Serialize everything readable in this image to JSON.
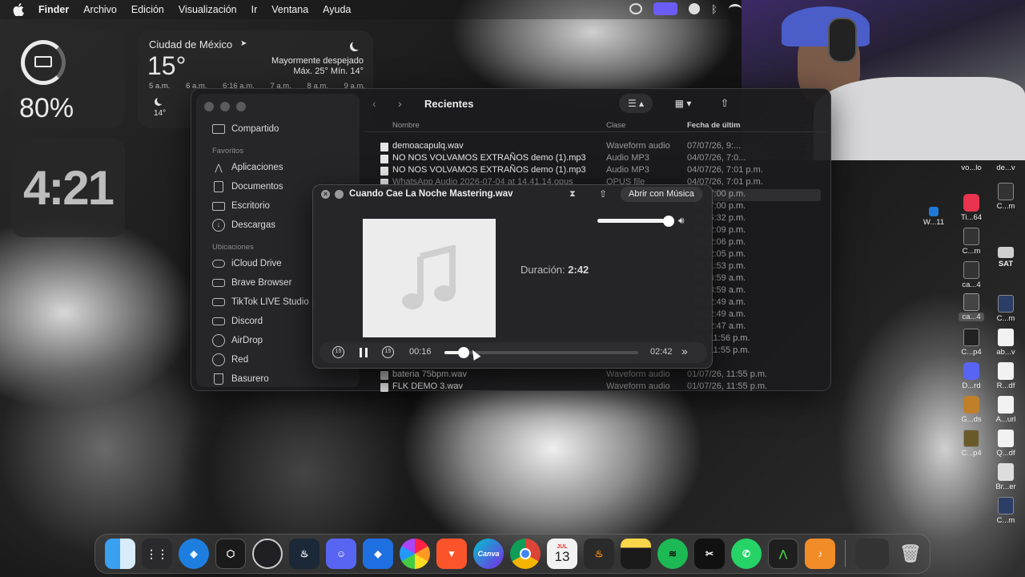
{
  "menubar": {
    "items": [
      "Finder",
      "Archivo",
      "Edición",
      "Visualización",
      "Ir",
      "Ventana",
      "Ayuda"
    ]
  },
  "battery_widget": {
    "percent": "80%"
  },
  "clock_widget": {
    "time": "4:21"
  },
  "weather_widget": {
    "city": "Ciudad de México",
    "temp": "15°",
    "condition": "Mayormente despejado",
    "range": "Máx. 25° Mín. 14°",
    "hours": [
      "5 a.m.",
      "6 a.m.",
      "6:16 a.m.",
      "7 a.m.",
      "8 a.m.",
      "9 a.m."
    ],
    "sub_temp": "14°"
  },
  "finder": {
    "title": "Recientes",
    "sidebar": {
      "top_item": "Compartido",
      "favorites_header": "Favoritos",
      "favorites": [
        "Aplicaciones",
        "Documentos",
        "Escritorio",
        "Descargas"
      ],
      "locations_header": "Ubicaciones",
      "locations": [
        "iCloud Drive",
        "Brave Browser",
        "TikTok LIVE Studio 1",
        "Discord",
        "AirDrop",
        "Red",
        "Basurero"
      ]
    },
    "columns": {
      "name": "Nombre",
      "kind": "Clase",
      "date": "Fecha de últim"
    },
    "files": [
      {
        "name": "demoacapulq.wav",
        "kind": "Waveform audio",
        "date": "07/07/26, 9:..."
      },
      {
        "name": "NO NOS VOLVAMOS EXTRAÑOS demo  (1).mp3",
        "kind": "Audio MP3",
        "date": "04/07/26, 7:0..."
      },
      {
        "name": "NO NOS VOLVAMOS EXTRAÑOS demo  (1).mp3",
        "kind": "Audio MP3",
        "date": "04/07/26, 7:01 p.m."
      },
      {
        "name": "WhatsApp Audio 2026-07-04 at 14.41.14.opus",
        "kind": "OPUS file",
        "date": "04/07/26, 7:01 p.m."
      }
    ],
    "partial_dates": [
      "26, 7:00 p.m.",
      "26, 7:00 p.m.",
      "26, 6:32 p.m.",
      "26, 2:09 p.m.",
      "26, 2:06 p.m.",
      "26, 2:05 p.m.",
      "26, 1:53 p.m.",
      "26, 3:59 a.m.",
      "26, 3:59 a.m.",
      "26, 2:49 a.m.",
      "26, 2:49 a.m.",
      "26, 2:47 a.m.",
      "26, 11:56 p.m.",
      "26, 11:55 p.m."
    ],
    "bottom_files": [
      {
        "name": "bateria 75bpm.wav",
        "kind": "Waveform audio",
        "date": "01/07/26, 11:55 p.m."
      },
      {
        "name": "FLK DEMO 3.wav",
        "kind": "Waveform audio",
        "date": "01/07/26, 11:55 p.m."
      }
    ]
  },
  "player": {
    "title": "Cuando Cae La Noche Mastering.wav",
    "open_with": "Abrir con Música",
    "duration_label": "Duración:",
    "duration_value": "2:42",
    "elapsed": "00:16",
    "total": "02:42",
    "progress": 0.1,
    "volume": 1.0
  },
  "desktop_icons": [
    "vo...lo",
    "de...v",
    "C...m",
    "Ti...64",
    "W...11",
    "C...m",
    "SAT",
    "ca...4",
    "C...m",
    "ca...4",
    "C...p4",
    "ab...v",
    "D...rd",
    "R...df",
    "G...ds",
    "A...url",
    "C...p4",
    "Q...df",
    "Br...er",
    "C...m"
  ],
  "dock": {
    "calendar_month": "JUL",
    "calendar_day": "13",
    "canva_label": "Canva"
  },
  "colors": {
    "accent": "#0a84ff",
    "brave": "#fb542b",
    "spotify": "#1db954",
    "discord": "#5865f2",
    "whatsapp": "#25d366",
    "steam": "#1b2838"
  }
}
